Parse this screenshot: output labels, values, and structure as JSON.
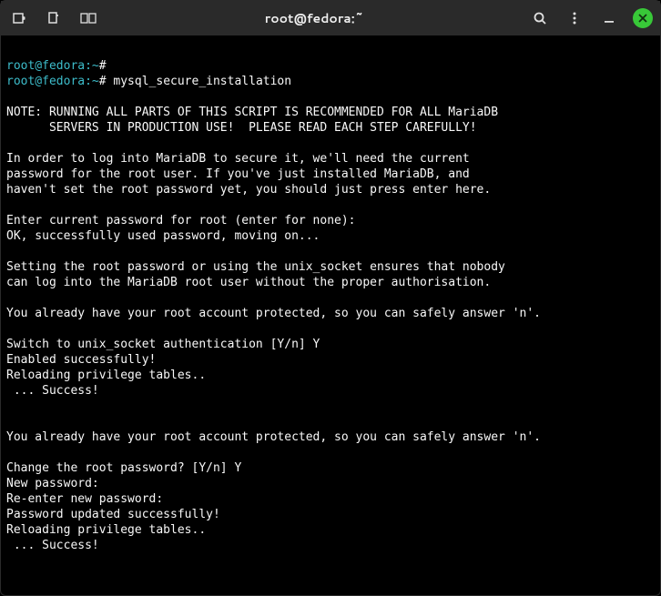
{
  "titlebar": {
    "title": "root@fedora:~"
  },
  "terminal": {
    "prompt_user": "root@fedora",
    "prompt_sep": ":",
    "prompt_path": "~",
    "prompt_hash": "#",
    "command": "mysql_secure_installation",
    "lines": [
      "",
      "NOTE: RUNNING ALL PARTS OF THIS SCRIPT IS RECOMMENDED FOR ALL MariaDB",
      "      SERVERS IN PRODUCTION USE!  PLEASE READ EACH STEP CAREFULLY!",
      "",
      "In order to log into MariaDB to secure it, we'll need the current",
      "password for the root user. If you've just installed MariaDB, and",
      "haven't set the root password yet, you should just press enter here.",
      "",
      "Enter current password for root (enter for none):",
      "OK, successfully used password, moving on...",
      "",
      "Setting the root password or using the unix_socket ensures that nobody",
      "can log into the MariaDB root user without the proper authorisation.",
      "",
      "You already have your root account protected, so you can safely answer 'n'.",
      "",
      "Switch to unix_socket authentication [Y/n] Y",
      "Enabled successfully!",
      "Reloading privilege tables..",
      " ... Success!",
      "",
      "",
      "You already have your root account protected, so you can safely answer 'n'.",
      "",
      "Change the root password? [Y/n] Y",
      "New password:",
      "Re-enter new password:",
      "Password updated successfully!",
      "Reloading privilege tables..",
      " ... Success!",
      ""
    ]
  }
}
